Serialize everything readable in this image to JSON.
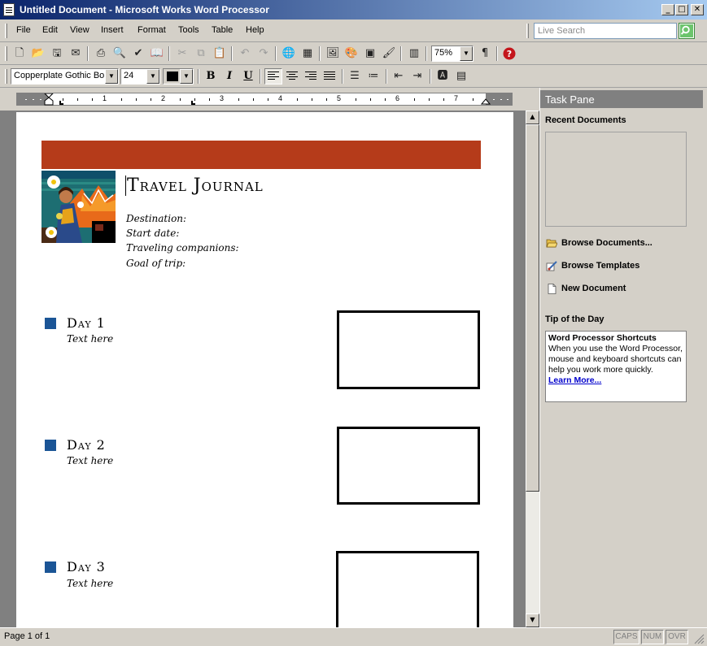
{
  "window": {
    "title": "Untitled Document - Microsoft Works Word Processor"
  },
  "menu": {
    "items": [
      "File",
      "Edit",
      "View",
      "Insert",
      "Format",
      "Tools",
      "Table",
      "Help"
    ]
  },
  "search": {
    "placeholder": "Live Search"
  },
  "toolbar": {
    "zoom": "75%"
  },
  "format": {
    "font": "Copperplate Gothic Bold",
    "size": "24",
    "bold": "B",
    "italic": "I",
    "underline": "U"
  },
  "ruler": {
    "numbers": [
      "1",
      "2",
      "3",
      "4",
      "5",
      "6",
      "7"
    ]
  },
  "document": {
    "title": "Travel Journal",
    "fields": [
      "Destination:",
      "Start date:",
      "Traveling companions:",
      "Goal of trip:"
    ],
    "days": [
      {
        "title": "Day 1",
        "text": "Text here"
      },
      {
        "title": "Day 2",
        "text": "Text here"
      },
      {
        "title": "Day 3",
        "text": "Text here"
      }
    ]
  },
  "taskpane": {
    "title": "Task Pane",
    "recent_label": "Recent Documents",
    "links": [
      "Browse Documents...",
      "Browse Templates",
      "New Document"
    ],
    "tip_label": "Tip of the Day",
    "tip_title": "Word Processor Shortcuts",
    "tip_body": "When you use the Word Processor, mouse and keyboard shortcuts can help you work more quickly.",
    "tip_link": "Learn More..."
  },
  "status": {
    "page": "Page 1 of 1",
    "caps": "CAPS",
    "num": "NUM",
    "ovr": "OVR"
  },
  "colors": {
    "banner": "#b53b1a",
    "bullet": "#1b5596",
    "titlebar": "#0a246a"
  }
}
